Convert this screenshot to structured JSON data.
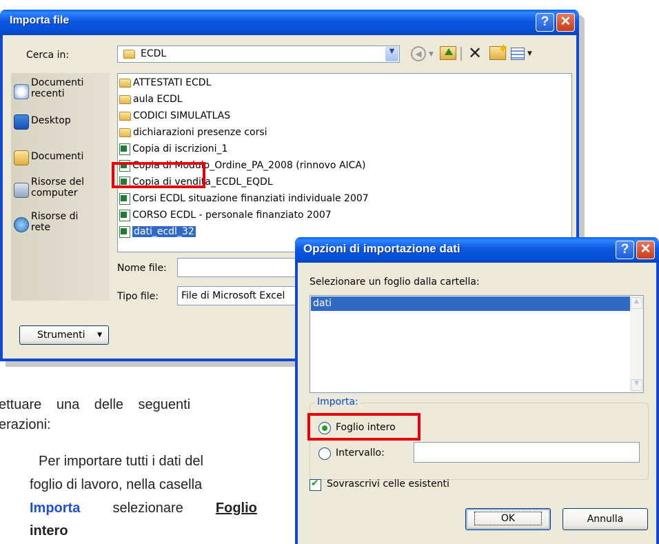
{
  "import_dialog": {
    "title": "Importa file",
    "help_icon": "?",
    "close_icon": "✕",
    "lookin_label": "Cerca in:",
    "lookin_value": "ECDL",
    "toolbar_icons": [
      "back-icon",
      "up-folder-icon",
      "delete-icon",
      "new-folder-icon",
      "views-icon"
    ],
    "places": [
      {
        "label": "Documenti recenti",
        "icon": "recent-documents-icon"
      },
      {
        "label": "Desktop",
        "icon": "desktop-icon"
      },
      {
        "label": "Documenti",
        "icon": "documents-icon"
      },
      {
        "label": "Risorse del computer",
        "icon": "computer-icon"
      },
      {
        "label": "Risorse di rete",
        "icon": "network-icon"
      }
    ],
    "files": [
      {
        "name": "ATTESTATI ECDL",
        "type": "folder"
      },
      {
        "name": "aula ECDL",
        "type": "folder"
      },
      {
        "name": "CODICI SIMULATLAS",
        "type": "folder"
      },
      {
        "name": "dichiarazioni presenze corsi",
        "type": "folder"
      },
      {
        "name": "Copia di iscrizioni_1",
        "type": "excel"
      },
      {
        "name": "Copia di Modulo_Ordine_PA_2008 (rinnovo AICA)",
        "type": "excel"
      },
      {
        "name": "Copia di vendita_ECDL_EQDL",
        "type": "excel"
      },
      {
        "name": "Corsi ECDL situazione finanziati individuale 2007",
        "type": "excel"
      },
      {
        "name": "CORSO ECDL - personale finanziato 2007",
        "type": "excel"
      },
      {
        "name": "dati_ecdl_32",
        "type": "excel",
        "selected": true
      }
    ],
    "filename_label": "Nome file:",
    "filename_value": "",
    "filetype_label": "Tipo file:",
    "filetype_value": "File di Microsoft Excel",
    "tools_button": "Strumenti"
  },
  "options_dialog": {
    "title": "Opzioni di importazione dati",
    "help_icon": "?",
    "close_icon": "✕",
    "sheet_label": "Selezionare un foglio dalla cartella:",
    "sheets": [
      "dati"
    ],
    "import_group": "Importa:",
    "radio_whole": "Foglio intero",
    "radio_whole_checked": true,
    "radio_range": "Intervallo:",
    "range_value": "",
    "overwrite_label": "Sovrascrivi celle esistenti",
    "overwrite_checked": true,
    "ok_button": "OK",
    "cancel_button": "Annulla"
  },
  "document": {
    "line1": "ettuare una delle seguenti",
    "line2": "erazioni:",
    "p_line1": "Per importare tutti i dati del",
    "p_line2": "foglio di lavoro, nella casella",
    "p_importa": "Importa",
    "p_selezionare": "selezionare",
    "p_foglio": "Foglio",
    "p_intero": "intero"
  },
  "colors": {
    "titlebar": "#0a5fe8",
    "highlight": "#e8000a",
    "selection": "#316ac5"
  }
}
